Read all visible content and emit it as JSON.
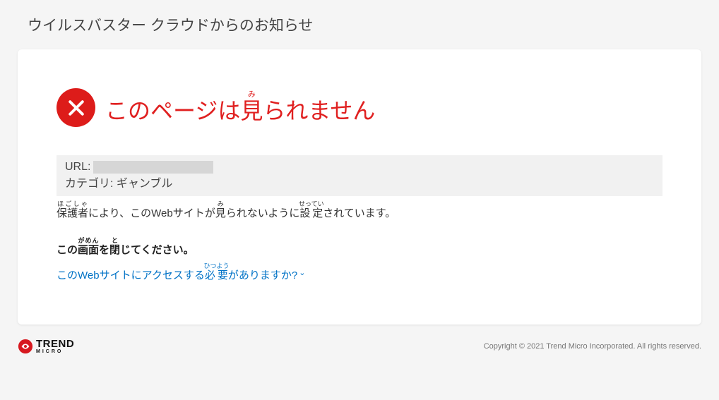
{
  "header": {
    "product_title": "ウイルスバスター クラウドからのお知らせ"
  },
  "block": {
    "headline": "このページは見られません",
    "url_label": "URL:",
    "category_label": "カテゴリ:",
    "category_value": "ギャンブル",
    "description": "保護者により、このWebサイトが見られないように設定されています。",
    "instruction": "この画面を閉じてください。",
    "access_link": "このWebサイトにアクセスする必要がありますか?"
  },
  "footer": {
    "brand_main": "TREND",
    "brand_sub": "MICRO",
    "copyright": "Copyright © 2021 Trend Micro Incorporated. All rights reserved."
  }
}
